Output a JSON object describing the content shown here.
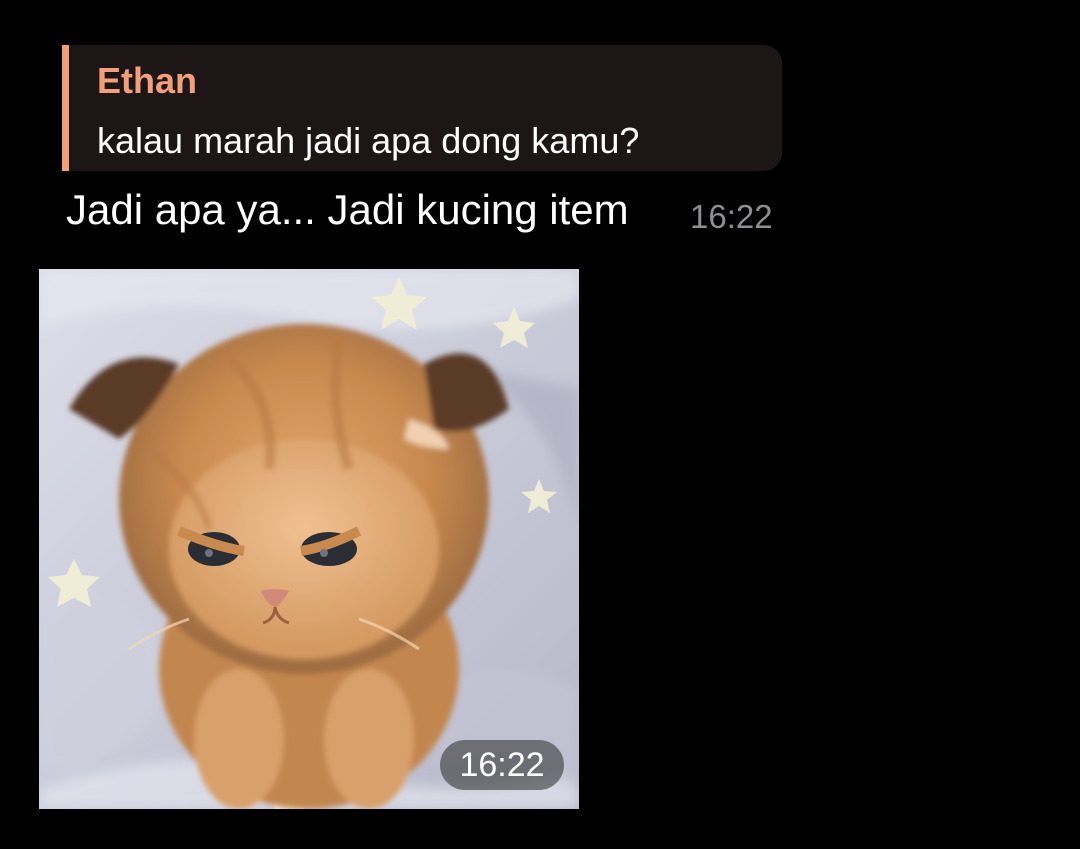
{
  "reply": {
    "sender": "Ethan",
    "text": "kalau marah jadi apa dong kamu?",
    "accent_color": "#f3a07a"
  },
  "message": {
    "text": "Jadi apa ya... Jadi kucing item",
    "time": "16:22"
  },
  "photo": {
    "subject": "angry-orange-kitten-on-star-blanket",
    "time": "16:22"
  }
}
